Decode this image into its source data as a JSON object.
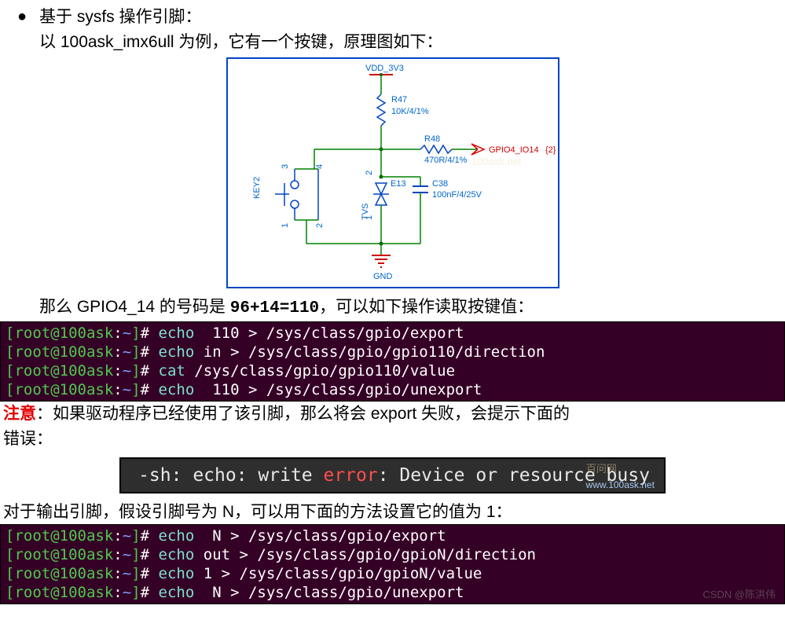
{
  "bullet_text": "基于 sysfs 操作引脚：",
  "intro_line": "以 100ask_imx6ull 为例，它有一个按键，原理图如下：",
  "schematic": {
    "vdd": "VDD_3V3",
    "r47": "R47",
    "r47_val": "10K/4/1%",
    "r48": "R48",
    "r48_val": "470R/4/1%",
    "gpio_label": "GPIO4_IO14",
    "gpio_net": "{2}",
    "key": "KEY2",
    "e13": "E13",
    "tvs": "TVS",
    "c38": "C38",
    "c38_val": "100nF/4/25V",
    "gnd": "GND",
    "pins_12": "1",
    "pins_2": "2",
    "pins_3": "3",
    "pins_4": "4",
    "watermark": "100ask.net"
  },
  "calc_line": {
    "pre": "那么 GPIO4_14 的号码是 ",
    "bold": "96+14=110",
    "post": "，可以如下操作读取按键值："
  },
  "term1": [
    {
      "prompt_open": "[",
      "user": "root@100ask",
      "colon": ":",
      "path": "~",
      "close": "]",
      "dollar": "# ",
      "cmd": "echo",
      "args": "  110 > /sys/class/gpio/export"
    },
    {
      "prompt_open": "[",
      "user": "root@100ask",
      "colon": ":",
      "path": "~",
      "close": "]",
      "dollar": "# ",
      "cmd": "echo",
      "args": " in > /sys/class/gpio/gpio110/direction"
    },
    {
      "prompt_open": "[",
      "user": "root@100ask",
      "colon": ":",
      "path": "~",
      "close": "]",
      "dollar": "# ",
      "cmd": "cat",
      "args": " /sys/class/gpio/gpio110/value"
    },
    {
      "prompt_open": "[",
      "user": "root@100ask",
      "colon": ":",
      "path": "~",
      "close": "]",
      "dollar": "# ",
      "cmd": "echo",
      "args": "  110 > /sys/class/gpio/unexport"
    }
  ],
  "note": {
    "label": "注意",
    "text1": "：如果驱动程序已经使用了该引脚，那么将会 export 失败，会提示下面的",
    "text2": "错误："
  },
  "error": {
    "pre": "-sh: echo: write ",
    "err": "error",
    "post": ": Device or resource busy",
    "wm_top": "百问网",
    "wm_bottom": "www.100ask.net"
  },
  "out_line": "对于输出引脚，假设引脚号为 N，可以用下面的方法设置它的值为 1：",
  "term2": [
    {
      "prompt_open": "[",
      "user": "root@100ask",
      "colon": ":",
      "path": "~",
      "close": "]",
      "dollar": "# ",
      "cmd": "echo",
      "args": "  N > /sys/class/gpio/export"
    },
    {
      "prompt_open": "[",
      "user": "root@100ask",
      "colon": ":",
      "path": "~",
      "close": "]",
      "dollar": "# ",
      "cmd": "echo",
      "args": " out > /sys/class/gpio/gpioN/direction"
    },
    {
      "prompt_open": "[",
      "user": "root@100ask",
      "colon": ":",
      "path": "~",
      "close": "]",
      "dollar": "# ",
      "cmd": "echo",
      "args": " 1 > /sys/class/gpio/gpioN/value"
    },
    {
      "prompt_open": "[",
      "user": "root@100ask",
      "colon": ":",
      "path": "~",
      "close": "]",
      "dollar": "# ",
      "cmd": "echo",
      "args": "  N > /sys/class/gpio/unexport"
    }
  ],
  "csdn": "CSDN @陈洪伟"
}
